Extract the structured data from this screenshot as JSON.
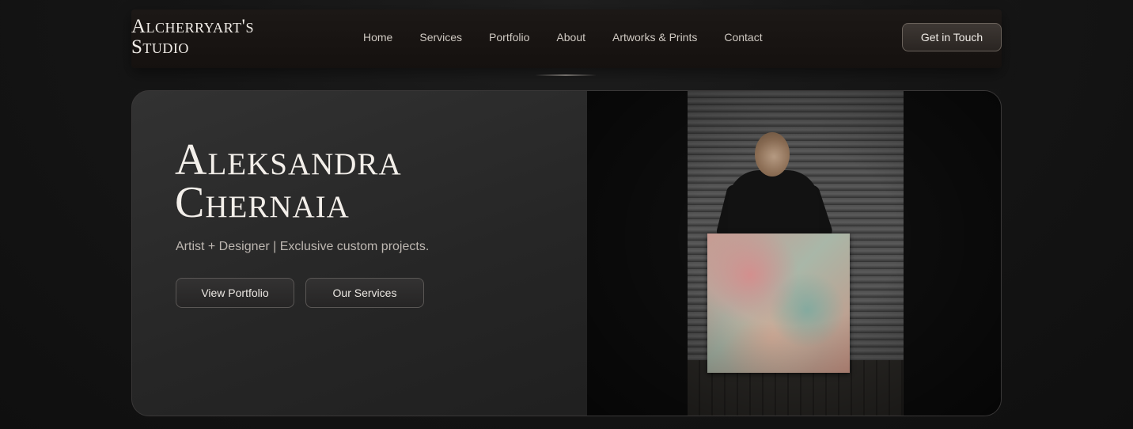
{
  "header": {
    "brand_line1": "Alcherryart's",
    "brand_line2": "Studio",
    "nav": [
      {
        "label": "Home"
      },
      {
        "label": "Services"
      },
      {
        "label": "Portfolio"
      },
      {
        "label": "About"
      },
      {
        "label": "Artworks & Prints"
      },
      {
        "label": "Contact"
      }
    ],
    "cta_label": "Get in Touch"
  },
  "hero": {
    "title_line1": "Aleksandra",
    "title_line2": "Chernaia",
    "subtitle": "Artist + Designer | Exclusive custom projects.",
    "primary_button": "View Portfolio",
    "secondary_button": "Our Services"
  },
  "colors": {
    "background": "#161616",
    "header_bg": "#1a1614",
    "accent_border": "#6a625b",
    "text_primary": "#f3efea",
    "text_secondary": "#bdb7b1"
  }
}
